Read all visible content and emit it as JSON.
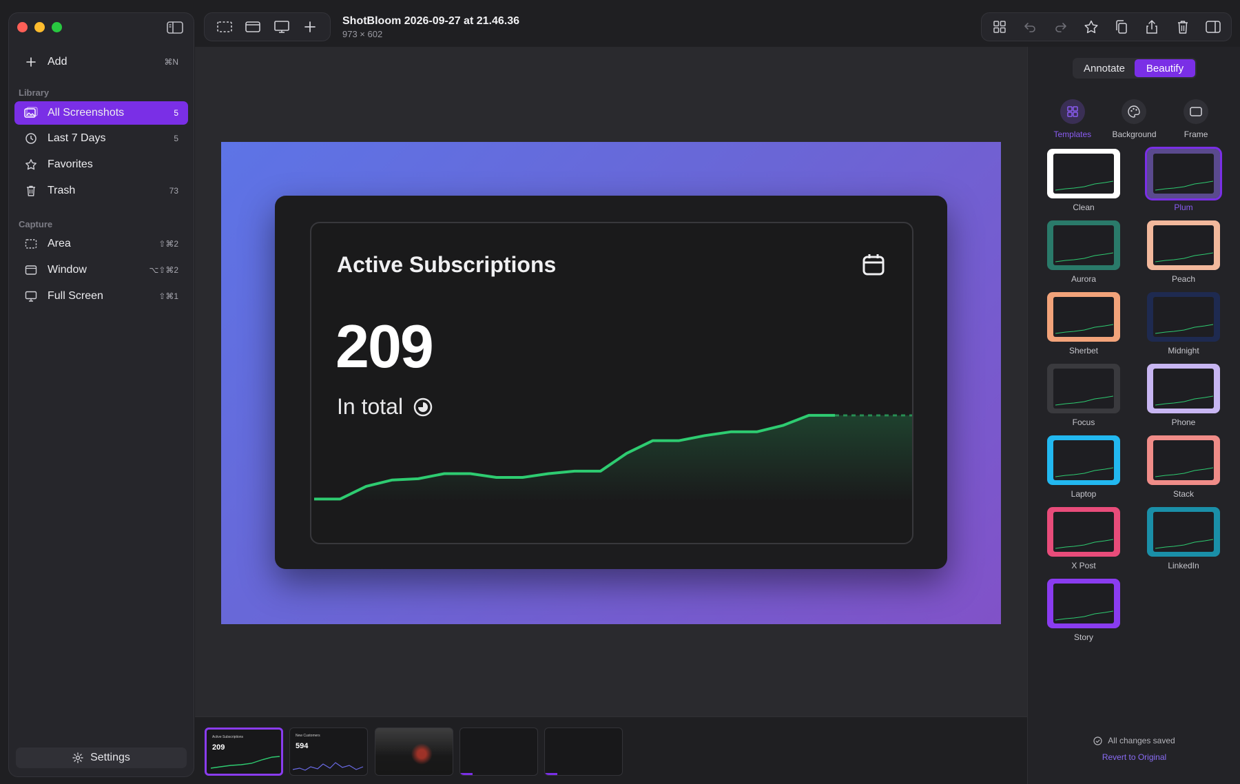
{
  "toolbar": {
    "doc_title": "ShotBloom 2026-09-27 at 21.46.36",
    "doc_size": "973 × 602"
  },
  "sidebar": {
    "add": {
      "label": "Add",
      "shortcut": "⌘N"
    },
    "library_label": "Library",
    "library_items": [
      {
        "label": "All Screenshots",
        "count": "5",
        "icon": "photos-icon"
      },
      {
        "label": "Last 7 Days",
        "count": "5",
        "icon": "clock-icon"
      },
      {
        "label": "Favorites",
        "count": "",
        "icon": "star-icon"
      },
      {
        "label": "Trash",
        "count": "73",
        "icon": "trash-icon"
      }
    ],
    "capture_label": "Capture",
    "capture_items": [
      {
        "label": "Area",
        "shortcut": "⇧⌘2",
        "icon": "area-icon"
      },
      {
        "label": "Window",
        "shortcut": "⌥⇧⌘2",
        "icon": "window-icon"
      },
      {
        "label": "Full Screen",
        "shortcut": "⇧⌘1",
        "icon": "display-icon"
      }
    ],
    "settings_label": "Settings"
  },
  "preview": {
    "title": "Active Subscriptions",
    "value": "209",
    "subtitle": "In total"
  },
  "chart_data": {
    "type": "line",
    "series": [
      {
        "values": [
          2,
          2,
          12,
          17,
          18,
          22,
          22,
          19,
          19,
          22,
          24,
          24,
          38,
          48,
          48,
          52,
          55,
          55,
          60,
          68,
          68
        ]
      }
    ],
    "ylim": [
      0,
      100
    ]
  },
  "filmstrip": {
    "thumbs": [
      {
        "title": "Active Subscriptions",
        "value": "209"
      },
      {
        "title": "New Customers",
        "value": "594"
      },
      {
        "title": "",
        "value": ""
      },
      {
        "title": "",
        "value": ""
      },
      {
        "title": "",
        "value": ""
      }
    ]
  },
  "rpanel": {
    "mode_annotate": "Annotate",
    "mode_beautify": "Beautify",
    "tabs": [
      "Templates",
      "Background",
      "Frame"
    ],
    "templates": [
      {
        "name": "Clean",
        "bg": "#ffffff"
      },
      {
        "name": "Plum",
        "bg": "#5a4a8e"
      },
      {
        "name": "Aurora",
        "bg": "#2a7a6a"
      },
      {
        "name": "Peach",
        "bg": "#f2b89c"
      },
      {
        "name": "Sherbet",
        "bg": "#f2a37a"
      },
      {
        "name": "Midnight",
        "bg": "#1e2a50"
      },
      {
        "name": "Focus",
        "bg": "#3a3a3e"
      },
      {
        "name": "Phone",
        "bg": "#c8b6f2"
      },
      {
        "name": "Laptop",
        "bg": "#22b8f0"
      },
      {
        "name": "Stack",
        "bg": "#f08c88"
      },
      {
        "name": "X Post",
        "bg": "#e84c7a"
      },
      {
        "name": "LinkedIn",
        "bg": "#1a8fa8"
      },
      {
        "name": "Story",
        "bg": "#8a3cf0"
      }
    ],
    "saved_text": "All changes saved",
    "revert_text": "Revert to Original"
  }
}
